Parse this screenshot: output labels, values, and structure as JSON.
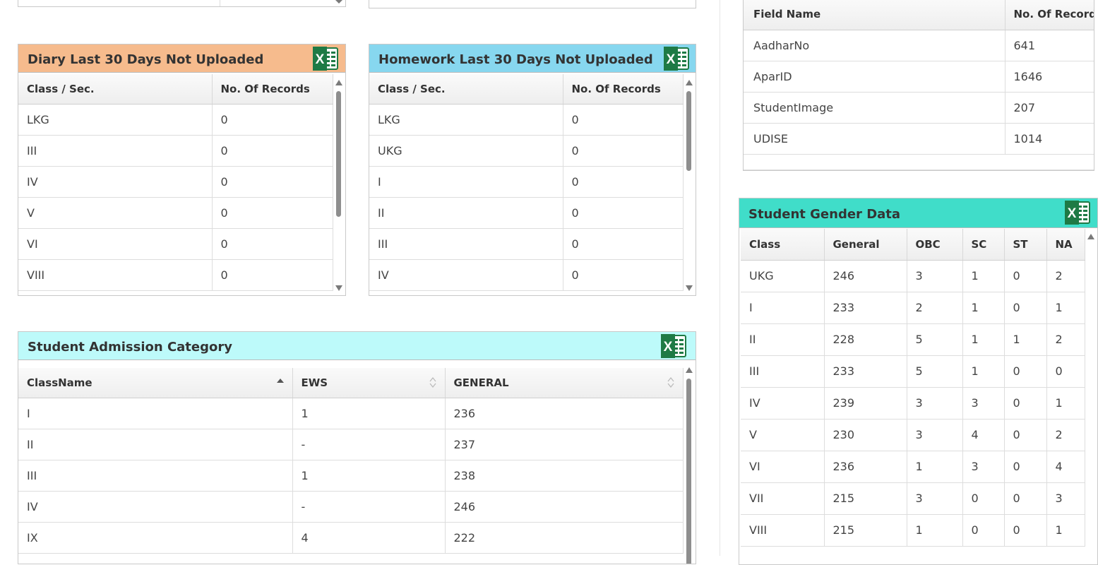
{
  "colors": {
    "diary_header": "#f6bb8d",
    "homework_header": "#87d7ef",
    "admission_header": "#bdfafa",
    "gender_header": "#40ddc9",
    "excel_green": "#1e7a45"
  },
  "icons": {
    "excel": "excel-export-icon",
    "sort_asc": "sort-ascending-icon",
    "sort_both": "sort-icon"
  },
  "diary": {
    "title": "Diary Last 30 Days Not Uploaded",
    "columns": [
      "Class / Sec.",
      "No. Of Records"
    ],
    "rows": [
      [
        "LKG",
        "0"
      ],
      [
        "III",
        "0"
      ],
      [
        "IV",
        "0"
      ],
      [
        "V",
        "0"
      ],
      [
        "VI",
        "0"
      ],
      [
        "VIII",
        "0"
      ]
    ]
  },
  "homework": {
    "title": "Homework Last 30 Days Not Uploaded",
    "columns": [
      "Class / Sec.",
      "No. Of Records"
    ],
    "rows": [
      [
        "LKG",
        "0"
      ],
      [
        "UKG",
        "0"
      ],
      [
        "I",
        "0"
      ],
      [
        "II",
        "0"
      ],
      [
        "III",
        "0"
      ],
      [
        "IV",
        "0"
      ]
    ]
  },
  "admission": {
    "title": "Student Admission Category",
    "columns": [
      "ClassName",
      "EWS",
      "GENERAL"
    ],
    "rows": [
      [
        "I",
        "1",
        "236"
      ],
      [
        "II",
        "-",
        "237"
      ],
      [
        "III",
        "1",
        "238"
      ],
      [
        "IV",
        "-",
        "246"
      ],
      [
        "IX",
        "4",
        "222"
      ]
    ]
  },
  "missing_fields": {
    "columns": [
      "Field Name",
      "No. Of Records"
    ],
    "rows": [
      [
        "AadharNo",
        "641"
      ],
      [
        "AparID",
        "1646"
      ],
      [
        "StudentImage",
        "207"
      ],
      [
        "UDISE",
        "1014"
      ]
    ]
  },
  "gender": {
    "title": "Student Gender Data",
    "columns": [
      "Class",
      "General",
      "OBC",
      "SC",
      "ST",
      "NA"
    ],
    "rows": [
      [
        "UKG",
        "246",
        "3",
        "1",
        "0",
        "2"
      ],
      [
        "I",
        "233",
        "2",
        "1",
        "0",
        "1"
      ],
      [
        "II",
        "228",
        "5",
        "1",
        "1",
        "2"
      ],
      [
        "III",
        "233",
        "5",
        "1",
        "0",
        "0"
      ],
      [
        "IV",
        "239",
        "3",
        "3",
        "0",
        "1"
      ],
      [
        "V",
        "230",
        "3",
        "4",
        "0",
        "2"
      ],
      [
        "VI",
        "236",
        "1",
        "3",
        "0",
        "4"
      ],
      [
        "VII",
        "215",
        "3",
        "0",
        "0",
        "3"
      ],
      [
        "VIII",
        "215",
        "1",
        "0",
        "0",
        "1"
      ]
    ]
  }
}
